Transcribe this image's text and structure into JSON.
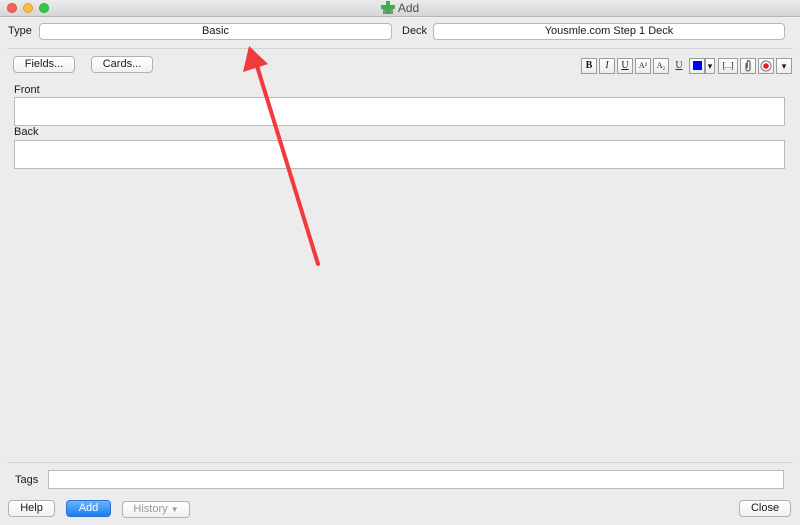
{
  "window": {
    "title": "Add"
  },
  "top": {
    "type_label": "Type",
    "type_value": "Basic",
    "deck_label": "Deck",
    "deck_value": "Yousmle.com Step 1 Deck"
  },
  "toolbar": {
    "fields_button": "Fields...",
    "cards_button": "Cards...",
    "format_buttons": [
      {
        "name": "bold",
        "glyph": "B"
      },
      {
        "name": "italic",
        "glyph": "I"
      },
      {
        "name": "underline",
        "glyph": "U"
      },
      {
        "name": "superscript",
        "glyph": "A²"
      },
      {
        "name": "subscript",
        "glyph": "A₂"
      },
      {
        "name": "clear-formatting",
        "glyph": "U"
      },
      {
        "name": "text-color",
        "glyph": "■"
      },
      {
        "name": "color-menu",
        "glyph": "▾"
      },
      {
        "name": "cloze",
        "glyph": "[...]"
      },
      {
        "name": "attach",
        "glyph": "📎"
      },
      {
        "name": "record",
        "glyph": "●"
      },
      {
        "name": "more",
        "glyph": "▾"
      }
    ],
    "text_color": "#0000ff"
  },
  "fields": [
    {
      "label": "Front",
      "value": ""
    },
    {
      "label": "Back",
      "value": ""
    }
  ],
  "tags": {
    "label": "Tags",
    "value": ""
  },
  "bottom": {
    "help_button": "Help",
    "add_button": "Add",
    "history_button": "History",
    "close_button": "Close"
  },
  "annotation": {
    "color": "#f23a3a"
  }
}
